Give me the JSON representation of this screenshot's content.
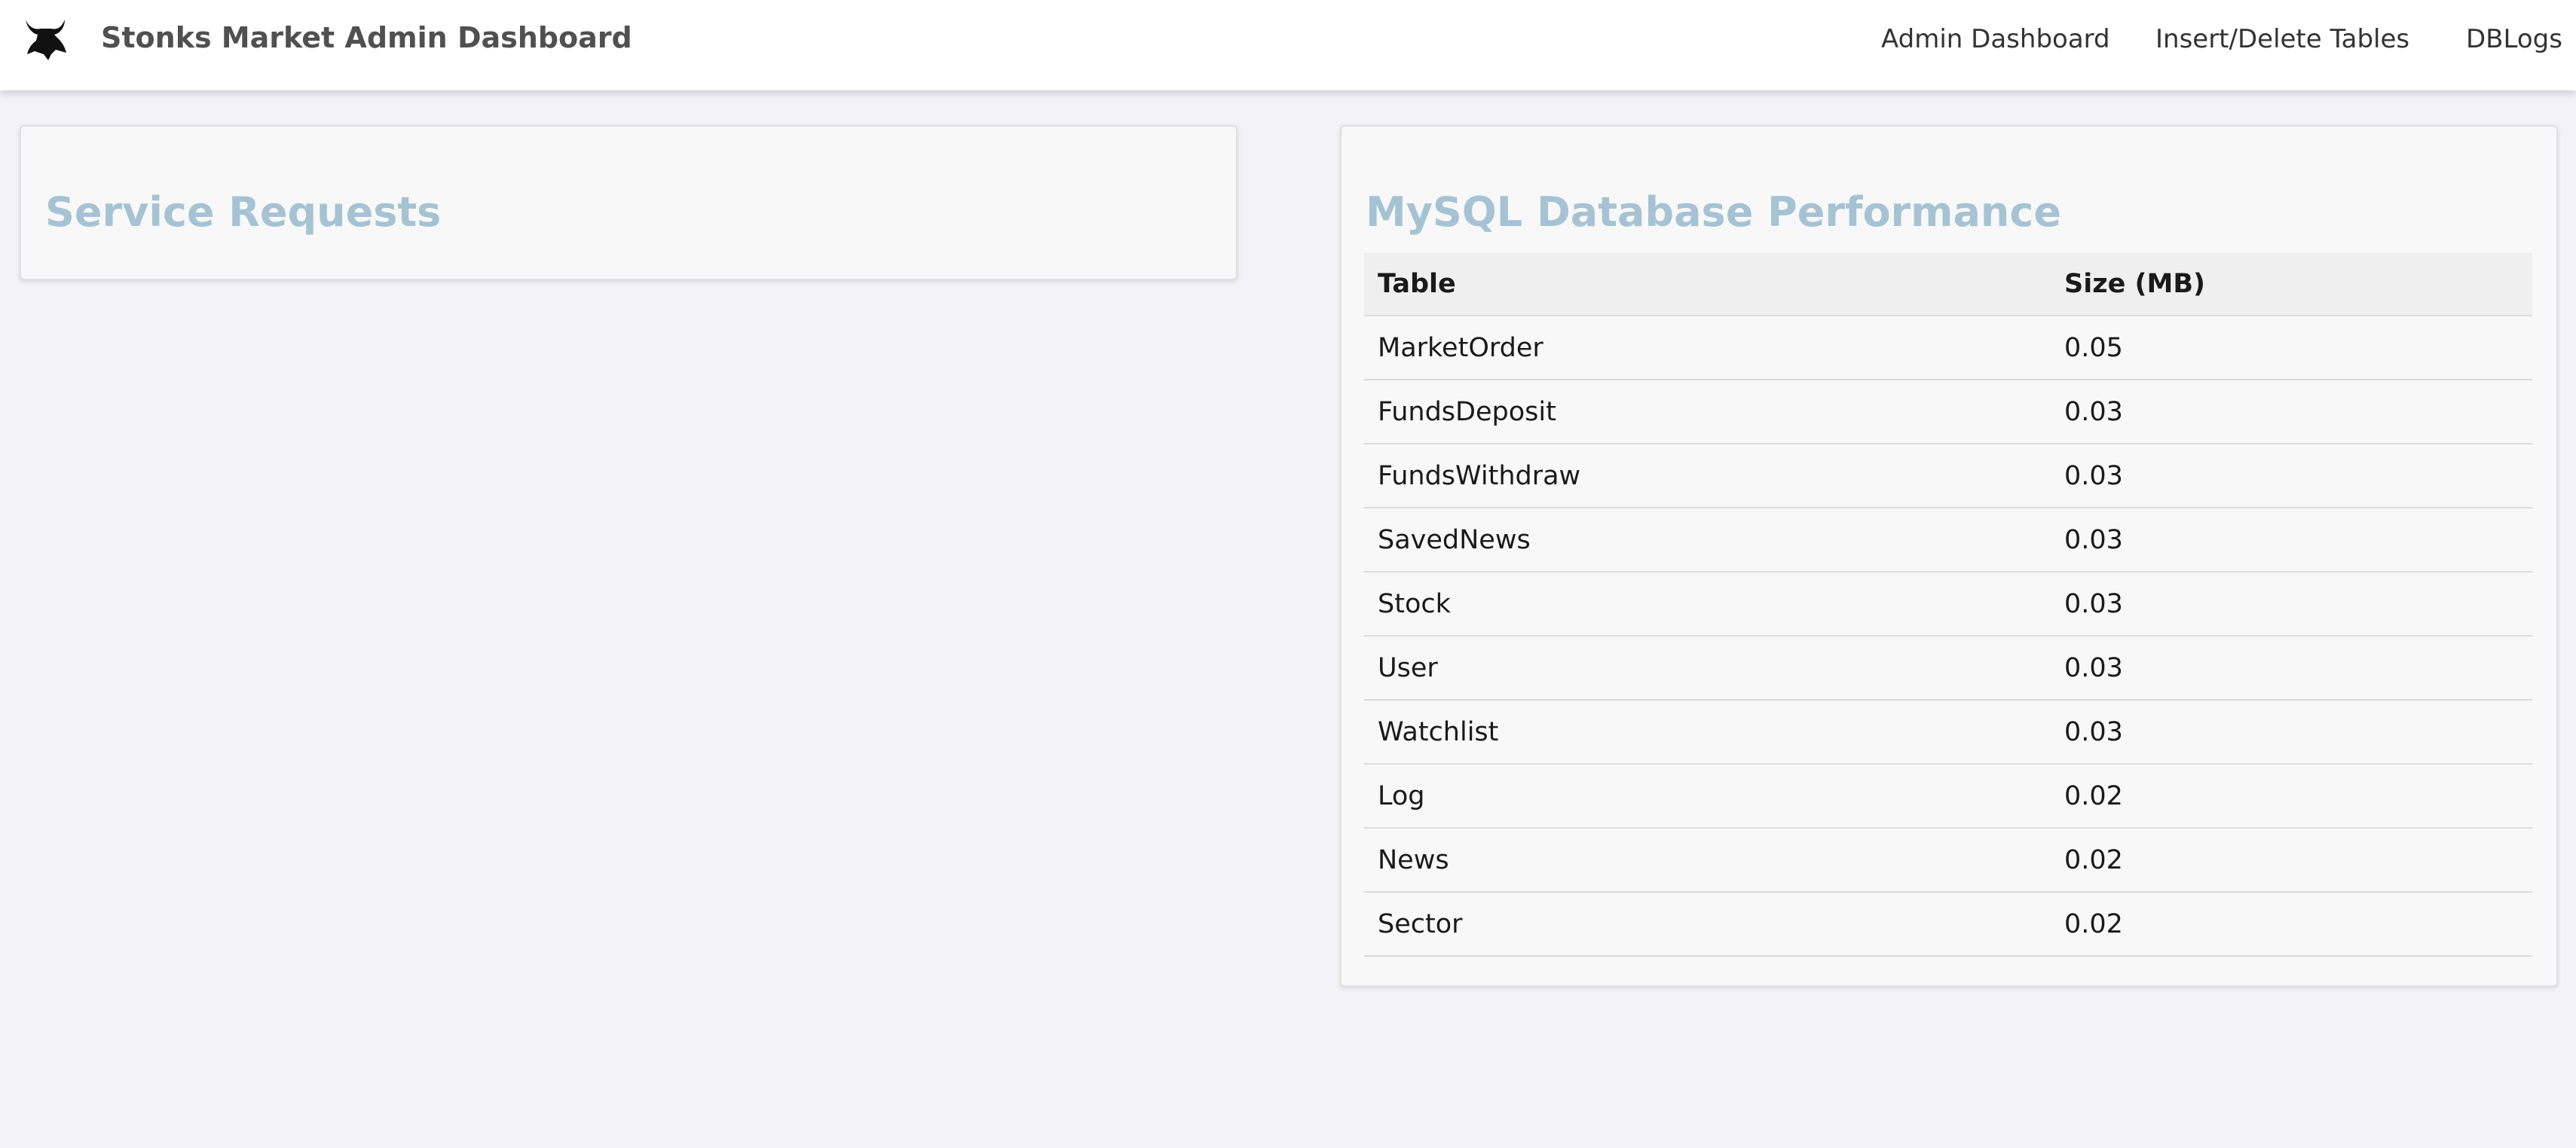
{
  "navbar": {
    "brand": "Stonks Market Admin Dashboard",
    "logo_icon": "bull-logo-icon",
    "links": [
      {
        "label": "Admin Dashboard"
      },
      {
        "label": "Insert/Delete Tables"
      },
      {
        "label": "DBLogs"
      }
    ]
  },
  "service_requests": {
    "title": "Service Requests"
  },
  "db_performance": {
    "title": "MySQL Database Performance",
    "columns": [
      "Table",
      "Size (MB)"
    ],
    "rows": [
      {
        "table": "MarketOrder",
        "size": "0.05"
      },
      {
        "table": "FundsDeposit",
        "size": "0.03"
      },
      {
        "table": "FundsWithdraw",
        "size": "0.03"
      },
      {
        "table": "SavedNews",
        "size": "0.03"
      },
      {
        "table": "Stock",
        "size": "0.03"
      },
      {
        "table": "User",
        "size": "0.03"
      },
      {
        "table": "Watchlist",
        "size": "0.03"
      },
      {
        "table": "Log",
        "size": "0.02"
      },
      {
        "table": "News",
        "size": "0.02"
      },
      {
        "table": "Sector",
        "size": "0.02"
      }
    ]
  },
  "colors": {
    "card_title": "#a6c3d4",
    "page_background": "#f2f2f7",
    "navbar_background": "#ffffff"
  }
}
